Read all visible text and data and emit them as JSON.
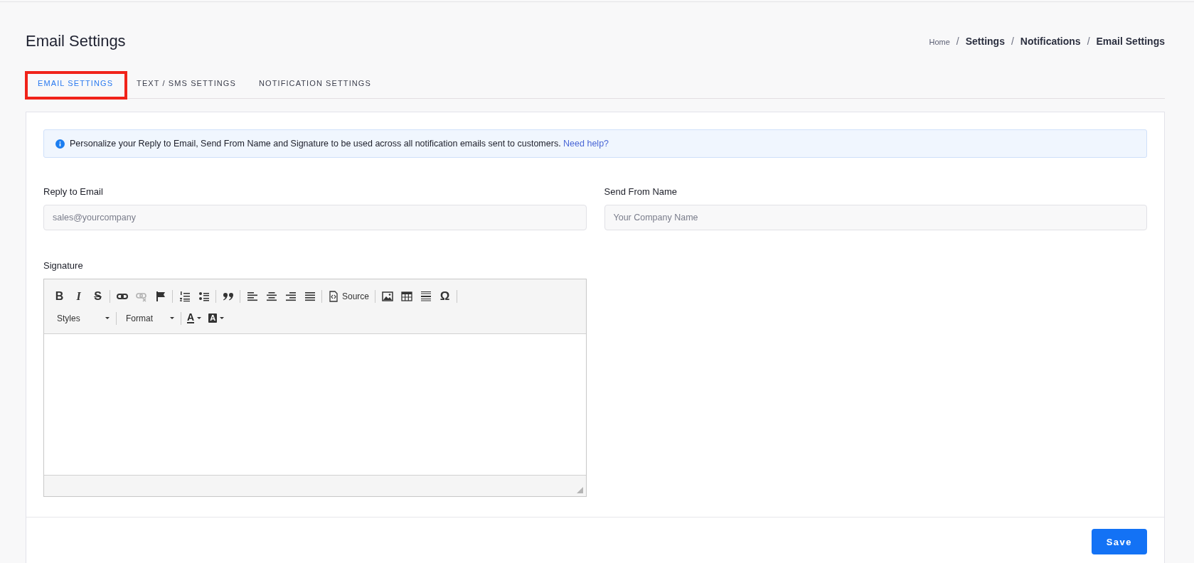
{
  "page_title": "Email Settings",
  "breadcrumb": [
    {
      "label": "Home",
      "current": false
    },
    {
      "label": "Settings",
      "current": true
    },
    {
      "label": "Notifications",
      "current": true
    },
    {
      "label": "Email Settings",
      "current": true
    }
  ],
  "breadcrumb_separator": "/",
  "tabs": [
    {
      "label": "EMAIL SETTINGS",
      "selected": true,
      "highlighted": true
    },
    {
      "label": "TEXT / SMS SETTINGS",
      "selected": false,
      "highlighted": false
    },
    {
      "label": "NOTIFICATION SETTINGS",
      "selected": false,
      "highlighted": false
    }
  ],
  "info": {
    "text": "Personalize your Reply to Email, Send From Name and Signature to be used across all notification emails sent to customers.",
    "link": "Need help?"
  },
  "fields": [
    {
      "label": "Reply to Email",
      "placeholder": "sales@yourcompany"
    },
    {
      "label": "Send From Name",
      "placeholder": "Your Company Name"
    }
  ],
  "signature": {
    "label": "Signature",
    "toolbar_rows": [
      [
        {
          "kind": "bold",
          "glyph": "B"
        },
        {
          "kind": "italic",
          "glyph": "I"
        },
        {
          "kind": "strike",
          "glyph": "S"
        },
        {
          "kind": "separator"
        },
        {
          "kind": "link"
        },
        {
          "kind": "unlink",
          "disabled": true
        },
        {
          "kind": "anchor"
        },
        {
          "kind": "separator"
        },
        {
          "kind": "numbered-list"
        },
        {
          "kind": "bulleted-list"
        },
        {
          "kind": "separator"
        },
        {
          "kind": "blockquote"
        },
        {
          "kind": "separator"
        },
        {
          "kind": "align-left"
        },
        {
          "kind": "align-center"
        },
        {
          "kind": "align-right"
        },
        {
          "kind": "justify"
        },
        {
          "kind": "separator"
        },
        {
          "kind": "source",
          "label": "Source"
        },
        {
          "kind": "separator"
        },
        {
          "kind": "image"
        },
        {
          "kind": "table"
        },
        {
          "kind": "horizontal-rule"
        },
        {
          "kind": "special-char",
          "glyph": "Ω"
        },
        {
          "kind": "separator"
        }
      ],
      [
        {
          "kind": "dropdown",
          "label": "Styles"
        },
        {
          "kind": "separator"
        },
        {
          "kind": "dropdown",
          "label": "Format"
        },
        {
          "kind": "separator"
        },
        {
          "kind": "text-color",
          "glyph": "A"
        },
        {
          "kind": "background-color",
          "glyph": "A"
        }
      ]
    ]
  },
  "save_button": {
    "label": "Save"
  }
}
